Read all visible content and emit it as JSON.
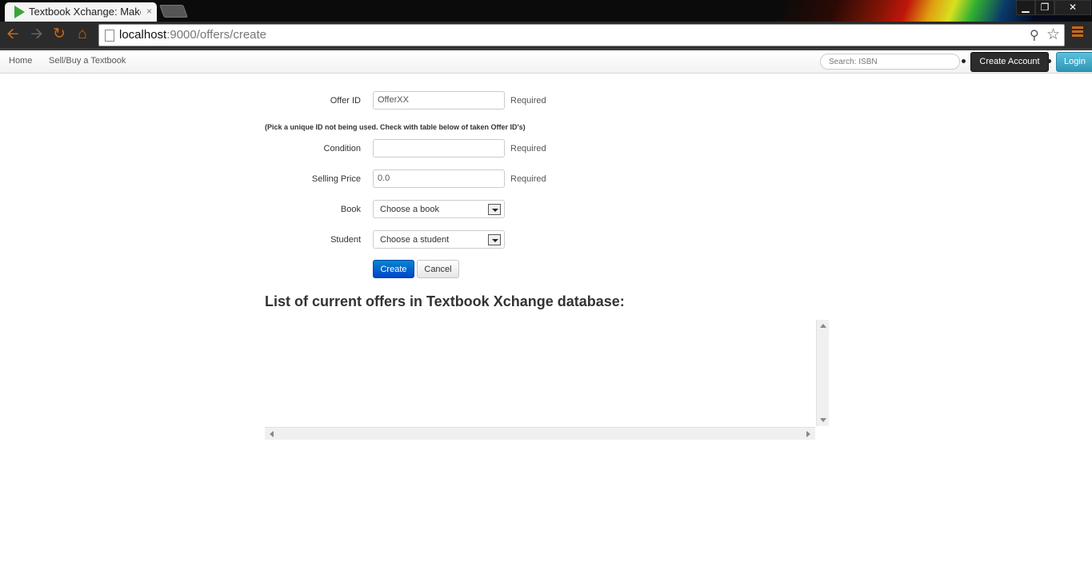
{
  "browser": {
    "tab_title": "Textbook Xchange: Make",
    "tab_close": "×",
    "url_host": "localhost",
    "url_rest": ":9000/offers/create",
    "window_min": "▁",
    "window_max": "❐",
    "window_close": "✕"
  },
  "navbar": {
    "home": "Home",
    "sell_buy": "Sell/Buy a Textbook",
    "search_placeholder": "Search: ISBN",
    "create_account": "Create Account",
    "login": "Login"
  },
  "form": {
    "offer_id": {
      "label": "Offer ID",
      "value": "OfferXX",
      "required": "Required"
    },
    "help_text": "(Pick a unique ID not being used. Check with table below of taken Offer ID's)",
    "condition": {
      "label": "Condition",
      "value": "",
      "required": "Required"
    },
    "selling_price": {
      "label": "Selling Price",
      "value": "0.0",
      "required": "Required"
    },
    "book": {
      "label": "Book",
      "selected": "Choose a book"
    },
    "student": {
      "label": "Student",
      "selected": "Choose a student"
    },
    "create": "Create",
    "cancel": "Cancel"
  },
  "offers_list": {
    "heading": "List of current offers in Textbook Xchange database:"
  },
  "colors": {
    "primary": "#0066cc",
    "info": "#49afcd",
    "dark": "#2c2c2c"
  }
}
